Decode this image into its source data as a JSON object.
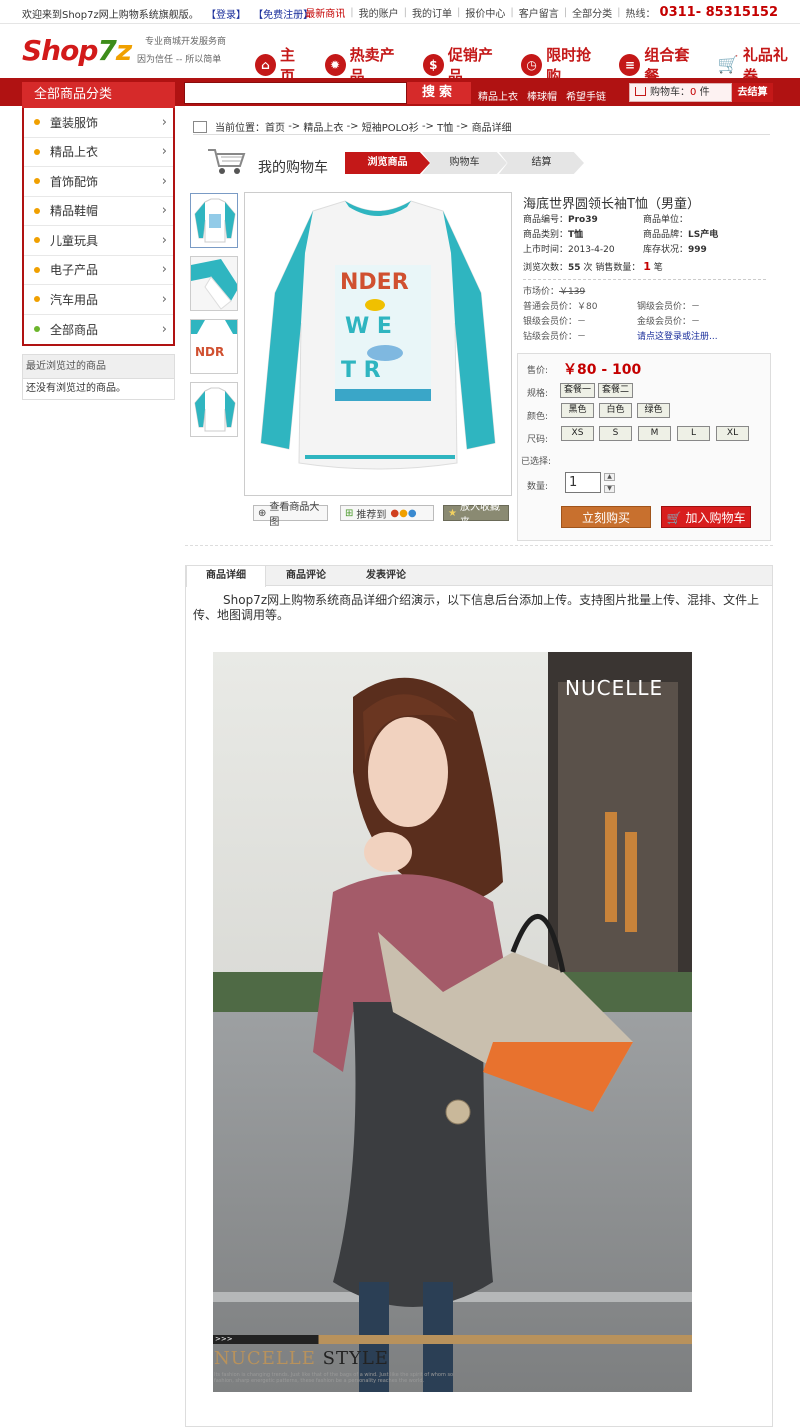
{
  "topbar": {
    "welcome": "欢迎来到Shop7z网上购物系统旗舰版。",
    "login": "【登录】",
    "register": "【免费注册】",
    "links": [
      "最新商讯",
      "我的账户",
      "我的订单",
      "报价中心",
      "客户留言",
      "全部分类"
    ],
    "hotline_label": "热线：",
    "hotline": "0311- 85315152"
  },
  "header": {
    "logo_a": "Shop",
    "logo_b": "7",
    "logo_c": "z",
    "slogan1": "专业商城开发服务商",
    "slogan2": "因为信任 -- 所以简单",
    "nav": [
      "主页",
      "热卖产品",
      "促销产品",
      "限时抢购",
      "组合套餐",
      "礼品礼券"
    ]
  },
  "searchbar": {
    "category_title": "全部商品分类",
    "search_placeholder": "",
    "search_button": "搜索",
    "hotwords": [
      "精品上衣",
      "棒球帽",
      "希望手链"
    ],
    "cart_label": "购物车：",
    "cart_count": "0",
    "cart_unit": "件",
    "checkout": "去结算"
  },
  "sidebar": {
    "categories": [
      "童装服饰",
      "精品上衣",
      "首饰配饰",
      "精品鞋帽",
      "儿童玩具",
      "电子产品",
      "汽车用品",
      "全部商品"
    ],
    "recent_title": "最近浏览过的商品",
    "recent_empty": "还没有浏览过的商品。"
  },
  "breadcrumb": {
    "prefix": "当前位置：",
    "items": [
      "首页",
      "精品上衣",
      "短袖POLO衫",
      "T恤",
      "商品详细"
    ],
    "sep": "->"
  },
  "cart_steps": {
    "title": "我的购物车",
    "steps": [
      "浏览商品",
      "购物车",
      "结算"
    ]
  },
  "image_tools": {
    "zoom": "查看商品大图",
    "recommend": "推荐到",
    "favorite": "放入收藏夹"
  },
  "product": {
    "title": "海底世界圆领长袖T恤（男童）",
    "code_label": "商品编号：",
    "code": "Pro39",
    "unit_label": "商品单位：",
    "unit": "",
    "type_label": "商品类别：",
    "type": "T恤",
    "brand_label": "商品品牌：",
    "brand": "LS产电",
    "date_label": "上市时间：",
    "date": "2013-4-20",
    "stock_label": "库存状况：",
    "stock": "999",
    "views_label": "浏览次数：",
    "views": "55",
    "views_unit": "次",
    "sales_label": "销售数量：",
    "sales": "1",
    "sales_unit": "笔",
    "market_label": "市场价：",
    "market_price": "￥139",
    "normal_label": "普通会员价：",
    "normal_price": "￥80",
    "steel_label": "钢级会员价：",
    "steel_price": "－",
    "silver_label": "银级会员价：",
    "silver_price": "－",
    "gold_label": "金级会员价：",
    "gold_price": "－",
    "diamond_label": "钻级会员价：",
    "diamond_price": "－",
    "login_hint": "请点这登录或注册..."
  },
  "buybox": {
    "price_label": "售价:",
    "price": "￥80 - 100",
    "spec_label": "规格:",
    "specs": [
      "套餐一",
      "套餐二"
    ],
    "color_label": "颜色:",
    "colors": [
      "黑色",
      "白色",
      "绿色"
    ],
    "size_label": "尺码:",
    "sizes": [
      "XS",
      "S",
      "M",
      "L",
      "XL"
    ],
    "selected_label": "已选择:",
    "qty_label": "数量:",
    "qty": "1",
    "buy_now": "立刻购买",
    "add_cart": "加入购物车"
  },
  "tabs": [
    "商品详细",
    "商品评论",
    "发表评论"
  ],
  "detail": {
    "text": "Shop7z网上购物系统商品详细介绍演示，以下信息后台添加上传。支持图片批量上传、混排、文件上传、地图调用等。",
    "brand_logo": "NUCELLE",
    "band_text": ">>>",
    "style_a": "NUCELLE",
    "style_b": " STYLE",
    "fine_print": "Its fashion is changing trends. Just like that of the bags of a wind. Just like the spirit of whom so fashion, sharp energetic patterns, these fashion be a personality reaches the world."
  },
  "colors": {
    "brand_red": "#b01212",
    "accent_red": "#c40000",
    "teal": "#2fb5c0",
    "buy_orange": "#c8702e"
  }
}
